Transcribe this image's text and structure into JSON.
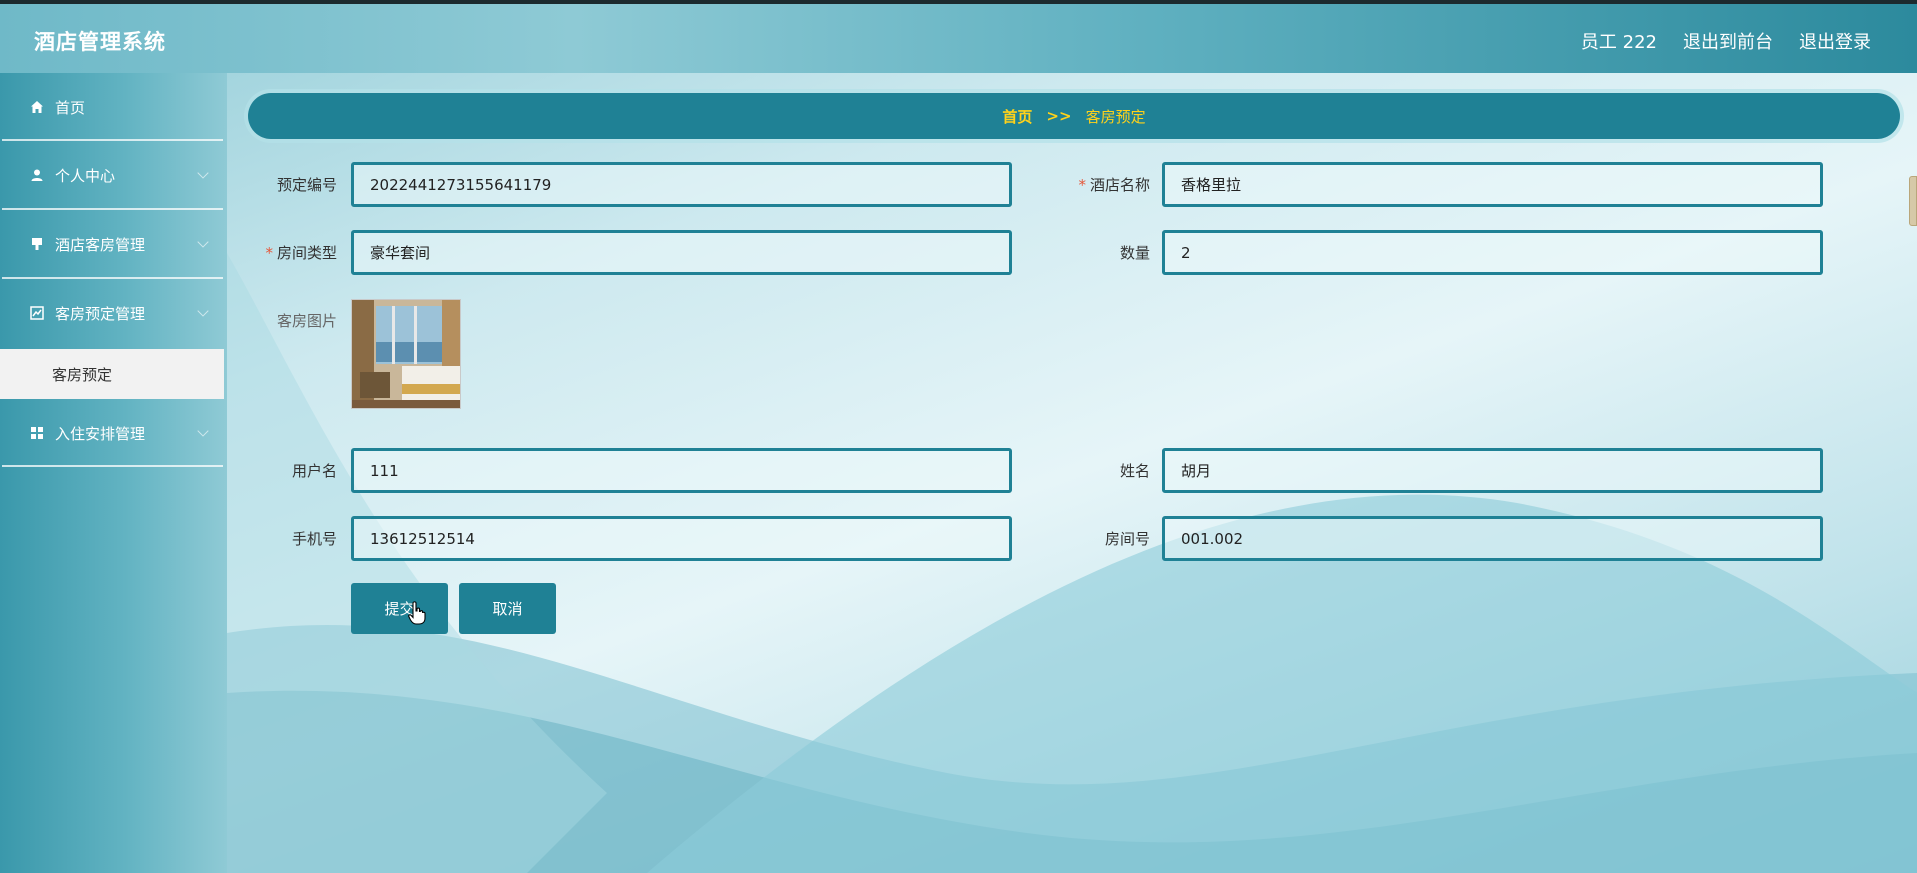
{
  "header": {
    "brand": "酒店管理系统",
    "user": "员工 222",
    "back_to_front": "退出到前台",
    "logout": "退出登录"
  },
  "sidebar": {
    "items": [
      {
        "label": "首页",
        "icon": "home-icon"
      },
      {
        "label": "个人中心",
        "icon": "user-icon"
      },
      {
        "label": "酒店客房管理",
        "icon": "hotel-icon"
      },
      {
        "label": "客房预定管理",
        "icon": "chart-icon"
      },
      {
        "label": "入住安排管理",
        "icon": "grid-icon"
      }
    ],
    "active_sub": "客房预定"
  },
  "breadcrumb": {
    "home": "首页",
    "sep": ">>",
    "current": "客房预定"
  },
  "form": {
    "booking_no_label": "预定编号",
    "booking_no": "2022441273155641179",
    "hotel_name_label": "酒店名称",
    "hotel_name": "香格里拉",
    "room_type_label": "房间类型",
    "room_type": "豪华套间",
    "quantity_label": "数量",
    "quantity": "2",
    "room_image_label": "客房图片",
    "username_label": "用户名",
    "username": "111",
    "name_label": "姓名",
    "name": "胡月",
    "phone_label": "手机号",
    "phone": "13612512514",
    "room_no_label": "房间号",
    "room_no": "001.002",
    "submit": "提交",
    "cancel": "取消"
  },
  "colors": {
    "accent": "#1f8195",
    "breadcrumb_text": "#ffd21a",
    "required": "#e5583b"
  }
}
